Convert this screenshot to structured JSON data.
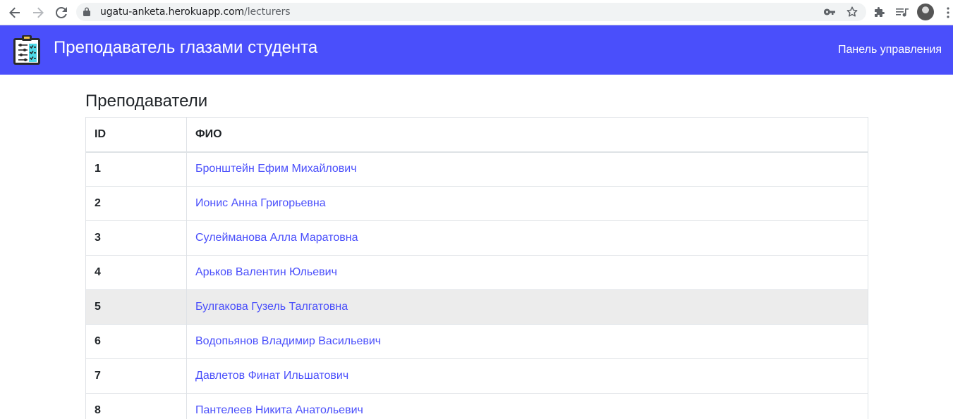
{
  "browser": {
    "url_host": "ugatu-anketa.herokuapp.com",
    "url_path": "/lecturers"
  },
  "header": {
    "brand": "Преподаватель глазами студента",
    "nav_link": "Панель управления",
    "accent_color": "#4a4ffb"
  },
  "main": {
    "title": "Преподаватели",
    "table": {
      "columns": [
        "ID",
        "ФИО"
      ],
      "rows": [
        {
          "id": "1",
          "name": "Бронштейн Ефим Михайлович"
        },
        {
          "id": "2",
          "name": "Ионис Анна Григорьевна"
        },
        {
          "id": "3",
          "name": "Сулейманова Алла Маратовна"
        },
        {
          "id": "4",
          "name": "Арьков Валентин Юльевич"
        },
        {
          "id": "5",
          "name": "Булгакова Гузель Талгатовна"
        },
        {
          "id": "6",
          "name": "Водопьянов Владимир Васильевич"
        },
        {
          "id": "7",
          "name": "Давлетов Финат Ильшатович"
        },
        {
          "id": "8",
          "name": "Пантелеев Никита Анатольевич"
        }
      ]
    }
  }
}
